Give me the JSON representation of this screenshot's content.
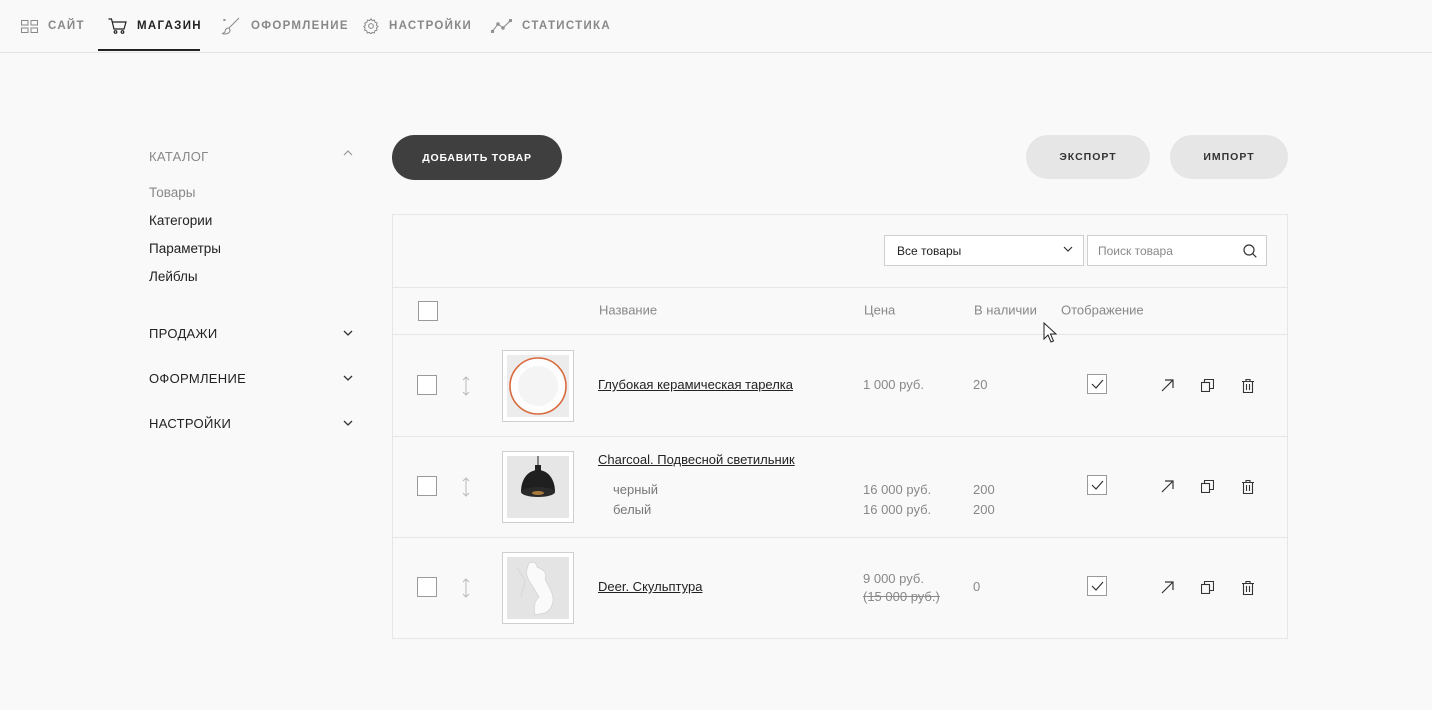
{
  "nav": {
    "items": [
      {
        "label": "САЙТ"
      },
      {
        "label": "МАГАЗИН"
      },
      {
        "label": "ОФОРМЛЕНИЕ"
      },
      {
        "label": "НАСТРОЙКИ"
      },
      {
        "label": "СТАТИСТИКА"
      }
    ],
    "active": "МАГАЗИН"
  },
  "sidebar": {
    "catalog": {
      "title": "КАТАЛОГ",
      "links": [
        "Товары",
        "Категории",
        "Параметры",
        "Лейблы"
      ]
    },
    "sections": [
      "ПРОДАЖИ",
      "ОФОРМЛЕНИЕ",
      "НАСТРОЙКИ"
    ]
  },
  "toolbar": {
    "add_label": "ДОБАВИТЬ ТОВАР",
    "export_label": "ЭКСПОРТ",
    "import_label": "ИМПОРТ"
  },
  "filter": {
    "selected": "Все товары",
    "search_placeholder": "Поиск товара"
  },
  "table": {
    "headers": {
      "name": "Название",
      "price": "Цена",
      "stock": "В наличии",
      "display": "Отображение"
    },
    "rows": [
      {
        "name": "Глубокая керамическая тарелка",
        "price": "1 000 руб.",
        "stock": "20",
        "visible": true
      },
      {
        "name": "Charcoal. Подвесной светильник",
        "variants": [
          {
            "name": "черный",
            "price": "16 000 руб.",
            "stock": "200"
          },
          {
            "name": "белый",
            "price": "16 000 руб.",
            "stock": "200"
          }
        ],
        "visible": true
      },
      {
        "name": "Deer. Скульптура",
        "price": "9 000 руб.",
        "old_price": "(15 000 руб.)",
        "stock": "0",
        "visible": true
      }
    ]
  },
  "icons": {
    "nav": [
      "grid-icon",
      "cart-icon",
      "brush-icon",
      "gear-icon",
      "chart-icon"
    ],
    "row_actions": [
      "open-link-icon",
      "copy-icon",
      "trash-icon"
    ]
  }
}
